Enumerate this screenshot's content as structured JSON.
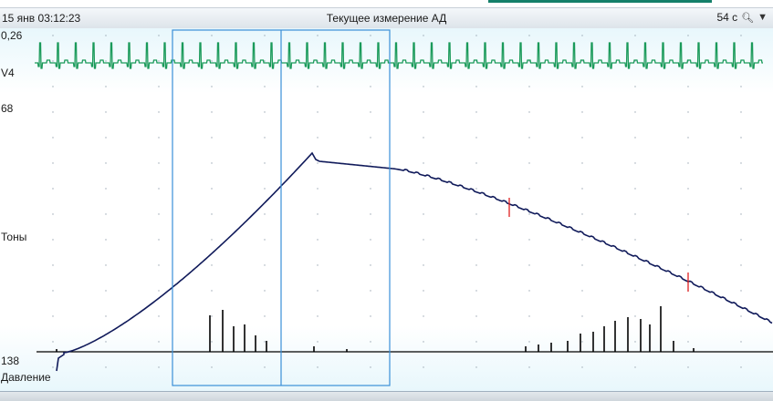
{
  "titlebar": {
    "datetime": "15 янв 03:12:23",
    "title": "Текущее измерение АД",
    "duration": "54 с",
    "search_icon": "magnifier-icon",
    "menu_icon": "chevron-down-icon"
  },
  "channels": {
    "ecg_scale": "0,26",
    "ecg_lead": "V4",
    "tones_scale": "68",
    "tones_label": "Тоны",
    "pressure_scale": "138",
    "pressure_label": "Давление"
  },
  "colors": {
    "ecg": "#1a9a5a",
    "pressure": "#101a5a",
    "tones": "#000000",
    "marker": "#e02020",
    "selection": "#3a8fd8",
    "grid": "#9aa7b3"
  },
  "selection": {
    "markers_count": 2
  }
}
